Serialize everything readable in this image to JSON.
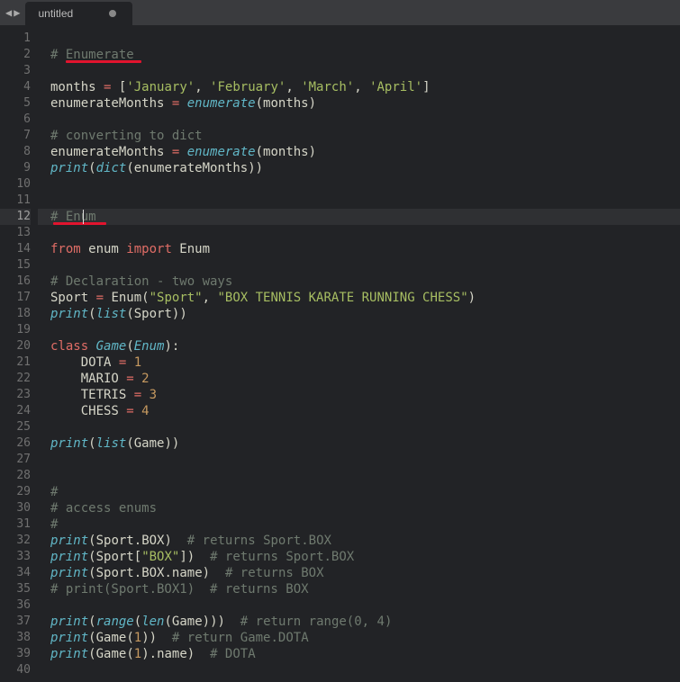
{
  "tab": {
    "title": "untitled",
    "dirty": true
  },
  "line_count": 40,
  "current_line": 12,
  "underlines": [
    {
      "line": 2,
      "left_ch": 2,
      "width_ch": 10
    },
    {
      "line": 12,
      "left_ch": 2,
      "width_ch": 7
    }
  ],
  "cursor": {
    "line": 12,
    "ch": 6
  },
  "code": {
    "1": [],
    "2": [
      [
        "c",
        "# "
      ],
      [
        "c",
        "Enumerate"
      ]
    ],
    "3": [],
    "4": [
      [
        "id",
        "months "
      ],
      [
        "op",
        "="
      ],
      [
        "id",
        " "
      ],
      [
        "p",
        "["
      ],
      [
        "s",
        "'January'"
      ],
      [
        "p",
        ", "
      ],
      [
        "s",
        "'February'"
      ],
      [
        "p",
        ", "
      ],
      [
        "s",
        "'March'"
      ],
      [
        "p",
        ", "
      ],
      [
        "s",
        "'April'"
      ],
      [
        "p",
        "]"
      ]
    ],
    "5": [
      [
        "id",
        "enumerateMonths "
      ],
      [
        "op",
        "="
      ],
      [
        "id",
        " "
      ],
      [
        "fn",
        "enumerate"
      ],
      [
        "p",
        "("
      ],
      [
        "id",
        "months"
      ],
      [
        "p",
        ")"
      ]
    ],
    "6": [],
    "7": [
      [
        "c",
        "# converting to dict"
      ]
    ],
    "8": [
      [
        "id",
        "enumerateMonths "
      ],
      [
        "op",
        "="
      ],
      [
        "id",
        " "
      ],
      [
        "fn",
        "enumerate"
      ],
      [
        "p",
        "("
      ],
      [
        "id",
        "months"
      ],
      [
        "p",
        ")"
      ]
    ],
    "9": [
      [
        "fn",
        "print"
      ],
      [
        "p",
        "("
      ],
      [
        "fn",
        "dict"
      ],
      [
        "p",
        "("
      ],
      [
        "id",
        "enumerateMonths"
      ],
      [
        "p",
        "))"
      ]
    ],
    "10": [],
    "11": [],
    "12": [
      [
        "c",
        "# Enum"
      ]
    ],
    "13": [],
    "14": [
      [
        "kw",
        "from"
      ],
      [
        "id",
        " enum "
      ],
      [
        "kw",
        "import"
      ],
      [
        "id",
        " Enum"
      ]
    ],
    "15": [],
    "16": [
      [
        "c",
        "# Declaration - two ways"
      ]
    ],
    "17": [
      [
        "id",
        "Sport "
      ],
      [
        "op",
        "="
      ],
      [
        "id",
        " Enum"
      ],
      [
        "p",
        "("
      ],
      [
        "s",
        "\"Sport\""
      ],
      [
        "p",
        ", "
      ],
      [
        "s",
        "\"BOX TENNIS KARATE RUNNING CHESS\""
      ],
      [
        "p",
        ")"
      ]
    ],
    "18": [
      [
        "fn",
        "print"
      ],
      [
        "p",
        "("
      ],
      [
        "fn",
        "list"
      ],
      [
        "p",
        "("
      ],
      [
        "id",
        "Sport"
      ],
      [
        "p",
        "))"
      ]
    ],
    "19": [],
    "20": [
      [
        "kw",
        "class"
      ],
      [
        "id",
        " "
      ],
      [
        "cls",
        "Game"
      ],
      [
        "p",
        "("
      ],
      [
        "cls",
        "Enum"
      ],
      [
        "p",
        "):"
      ]
    ],
    "21": [
      [
        "id",
        "    DOTA "
      ],
      [
        "op",
        "="
      ],
      [
        "id",
        " "
      ],
      [
        "n",
        "1"
      ]
    ],
    "22": [
      [
        "id",
        "    MARIO "
      ],
      [
        "op",
        "="
      ],
      [
        "id",
        " "
      ],
      [
        "n",
        "2"
      ]
    ],
    "23": [
      [
        "id",
        "    TETRIS "
      ],
      [
        "op",
        "="
      ],
      [
        "id",
        " "
      ],
      [
        "n",
        "3"
      ]
    ],
    "24": [
      [
        "id",
        "    CHESS "
      ],
      [
        "op",
        "="
      ],
      [
        "id",
        " "
      ],
      [
        "n",
        "4"
      ]
    ],
    "25": [],
    "26": [
      [
        "fn",
        "print"
      ],
      [
        "p",
        "("
      ],
      [
        "fn",
        "list"
      ],
      [
        "p",
        "("
      ],
      [
        "id",
        "Game"
      ],
      [
        "p",
        "))"
      ]
    ],
    "27": [],
    "28": [],
    "29": [
      [
        "c",
        "#"
      ]
    ],
    "30": [
      [
        "c",
        "# access enums"
      ]
    ],
    "31": [
      [
        "c",
        "#"
      ]
    ],
    "32": [
      [
        "fn",
        "print"
      ],
      [
        "p",
        "("
      ],
      [
        "id",
        "Sport"
      ],
      [
        "p",
        "."
      ],
      [
        "id",
        "BOX"
      ],
      [
        "p",
        ")  "
      ],
      [
        "c",
        "# returns Sport.BOX"
      ]
    ],
    "33": [
      [
        "fn",
        "print"
      ],
      [
        "p",
        "("
      ],
      [
        "id",
        "Sport"
      ],
      [
        "p",
        "["
      ],
      [
        "s",
        "\"BOX\""
      ],
      [
        "p",
        "])  "
      ],
      [
        "c",
        "# returns Sport.BOX"
      ]
    ],
    "34": [
      [
        "fn",
        "print"
      ],
      [
        "p",
        "("
      ],
      [
        "id",
        "Sport"
      ],
      [
        "p",
        "."
      ],
      [
        "id",
        "BOX"
      ],
      [
        "p",
        "."
      ],
      [
        "id",
        "name"
      ],
      [
        "p",
        ")  "
      ],
      [
        "c",
        "# returns BOX"
      ]
    ],
    "35": [
      [
        "c",
        "# print(Sport.BOX1)  # returns BOX"
      ]
    ],
    "36": [],
    "37": [
      [
        "fn",
        "print"
      ],
      [
        "p",
        "("
      ],
      [
        "fn",
        "range"
      ],
      [
        "p",
        "("
      ],
      [
        "fn",
        "len"
      ],
      [
        "p",
        "("
      ],
      [
        "id",
        "Game"
      ],
      [
        "p",
        ")))  "
      ],
      [
        "c",
        "# return range(0, 4)"
      ]
    ],
    "38": [
      [
        "fn",
        "print"
      ],
      [
        "p",
        "("
      ],
      [
        "id",
        "Game"
      ],
      [
        "p",
        "("
      ],
      [
        "n",
        "1"
      ],
      [
        "p",
        "))  "
      ],
      [
        "c",
        "# return Game.DOTA"
      ]
    ],
    "39": [
      [
        "fn",
        "print"
      ],
      [
        "p",
        "("
      ],
      [
        "id",
        "Game"
      ],
      [
        "p",
        "("
      ],
      [
        "n",
        "1"
      ],
      [
        "p",
        ")"
      ],
      [
        "p",
        "."
      ],
      [
        "id",
        "name"
      ],
      [
        "p",
        ")  "
      ],
      [
        "c",
        "# DOTA"
      ]
    ],
    "40": []
  }
}
